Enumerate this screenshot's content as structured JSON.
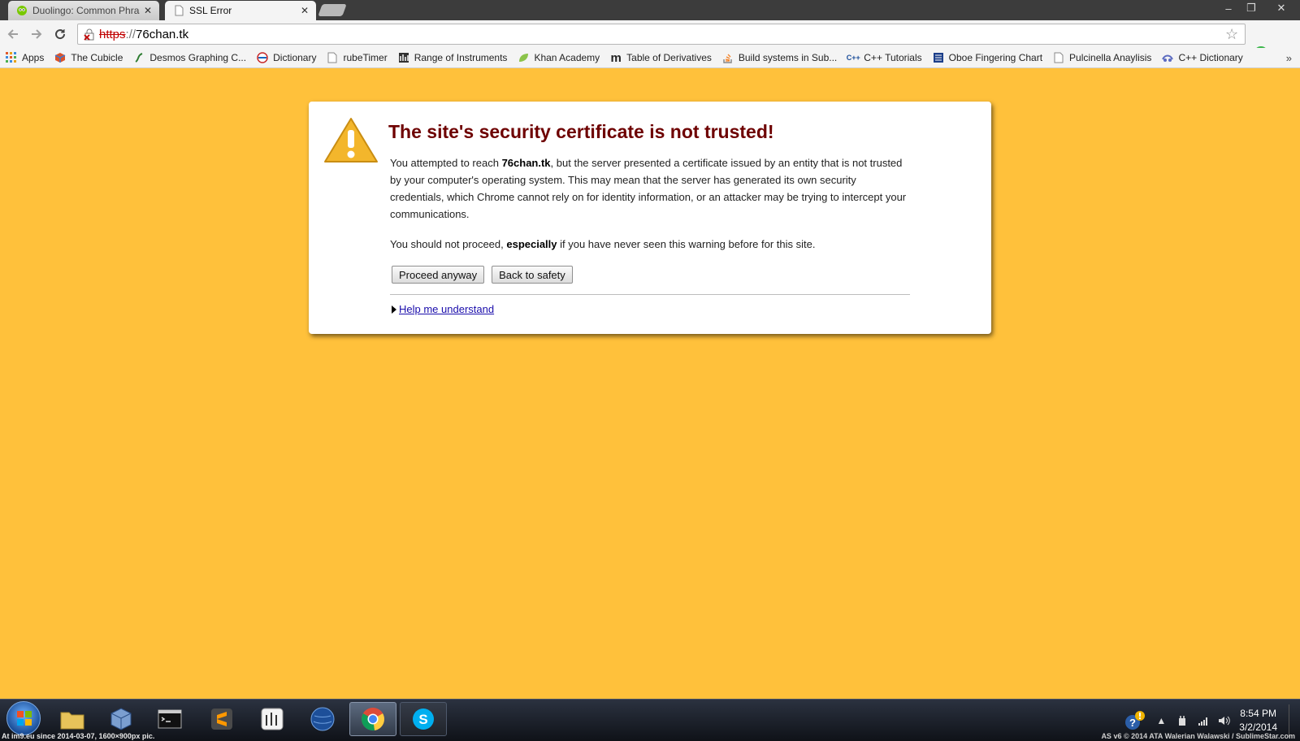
{
  "tabs": [
    {
      "title": "Duolingo: Common Phras",
      "active": false
    },
    {
      "title": "SSL Error",
      "active": true
    }
  ],
  "window": {
    "minimize": "–",
    "restore": "❐",
    "close": "✕"
  },
  "omnibox": {
    "scheme": "https",
    "separator": "://",
    "host": "76chan.tk"
  },
  "bookmarks": [
    {
      "label": "Apps",
      "icon": "apps-grid-icon"
    },
    {
      "label": "The Cubicle",
      "icon": "cube-icon"
    },
    {
      "label": "Desmos Graphing C...",
      "icon": "desmos-icon"
    },
    {
      "label": "Dictionary",
      "icon": "dictionary-icon"
    },
    {
      "label": "rubeTimer",
      "icon": "page-icon"
    },
    {
      "label": "Range of Instruments",
      "icon": "instruments-icon"
    },
    {
      "label": "Khan Academy",
      "icon": "leaf-icon"
    },
    {
      "label": "Table of Derivatives",
      "icon": "m-logo-icon"
    },
    {
      "label": "Build systems in Sub...",
      "icon": "stackoverflow-icon"
    },
    {
      "label": "C++ Tutorials",
      "icon": "cpp-icon"
    },
    {
      "label": "Oboe Fingering Chart",
      "icon": "chart-icon"
    },
    {
      "label": "Pulcinella Anaylisis",
      "icon": "page-icon"
    },
    {
      "label": "C++ Dictionary",
      "icon": "cpp-dict-icon"
    }
  ],
  "bookmarks_more": "»",
  "interstitial": {
    "title": "The site's security certificate is not trusted!",
    "para1_before": "You attempted to reach ",
    "para1_host": "76chan.tk",
    "para1_after": ", but the server presented a certificate issued by an entity that is not trusted by your computer's operating system. This may mean that the server has generated its own security credentials, which Chrome cannot rely on for identity information, or an attacker may be trying to intercept your communications.",
    "para2_before": "You should not proceed, ",
    "para2_bold": "especially",
    "para2_after": " if you have never seen this warning before for this site.",
    "proceed_label": "Proceed anyway",
    "back_label": "Back to safety",
    "help_label": "Help me understand"
  },
  "taskbar": {
    "apps": [
      {
        "name": "file-explorer",
        "color": "#e7c35a"
      },
      {
        "name": "virtualbox",
        "color": "#7b9fd0"
      },
      {
        "name": "command-prompt",
        "color": "#111111"
      },
      {
        "name": "sublime-text",
        "color": "#4a4a4a"
      },
      {
        "name": "musescore",
        "color": "#f4f4f4"
      },
      {
        "name": "stellarium",
        "color": "#1d4f99"
      },
      {
        "name": "chrome",
        "color": "#dd4b39"
      },
      {
        "name": "skype",
        "color": "#00aff0"
      }
    ],
    "clock_time": "8:54 PM",
    "clock_date": "3/2/2014"
  },
  "watermark": {
    "left": "At im9.eu  since 2014-03-07, 1600×900px pic.",
    "right": "AS v6 © 2014 ATA Walerian Walawski / SublimeStar.com"
  },
  "colors": {
    "page_bg": "#ffc13b",
    "title": "#6e0000",
    "link": "#1a0dab"
  }
}
